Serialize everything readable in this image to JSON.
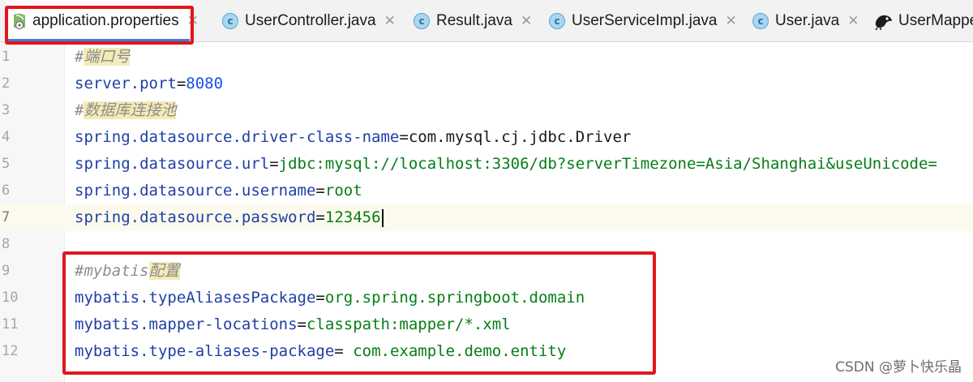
{
  "tabs": [
    {
      "label": "application.properties",
      "icon": "spring-properties-icon",
      "active": true
    },
    {
      "label": "UserController.java",
      "icon": "java-class-icon",
      "active": false
    },
    {
      "label": "Result.java",
      "icon": "java-class-icon",
      "active": false
    },
    {
      "label": "UserServiceImpl.java",
      "icon": "java-class-icon",
      "active": false
    },
    {
      "label": "User.java",
      "icon": "java-class-icon",
      "active": false
    },
    {
      "label": "UserMappe",
      "icon": "mybatis-bird-icon",
      "active": false
    }
  ],
  "tab_close_glyph": "✕",
  "class_icon_letter": "c",
  "lines": [
    {
      "num": "1",
      "comment_prefix": "#",
      "comment_text": "端口号"
    },
    {
      "num": "2",
      "key": "server.port",
      "eq": "=",
      "value": "8080"
    },
    {
      "num": "3",
      "comment_prefix": "#",
      "comment_text": "数据库连接池"
    },
    {
      "num": "4",
      "key": "spring.datasource.driver-class-name",
      "eq": "=",
      "value": "com.mysql.cj.jdbc.Driver"
    },
    {
      "num": "5",
      "key": "spring.datasource.url",
      "eq": "=",
      "value": "jdbc:mysql://localhost:3306/db?serverTimezone=Asia/Shanghai&useUnicode="
    },
    {
      "num": "6",
      "key": "spring.datasource.username",
      "eq": "=",
      "value": "root"
    },
    {
      "num": "7",
      "key": "spring.datasource.password",
      "eq": "=",
      "value": "123456"
    },
    {
      "num": "8"
    },
    {
      "num": "9",
      "comment_prefix": "#mybatis",
      "comment_text": "配置"
    },
    {
      "num": "10",
      "key": "mybatis.typeAliasesPackage",
      "eq": "=",
      "value": "org.spring.springboot.domain"
    },
    {
      "num": "11",
      "key": "mybatis.mapper-locations",
      "eq": "=",
      "value": "classpath:mapper/*.xml"
    },
    {
      "num": "12",
      "key": "mybatis.type-aliases-package",
      "eq": "=",
      "value": " com.example.demo.entity"
    }
  ],
  "watermark": "CSDN @萝卜快乐晶",
  "colors": {
    "highlight_box": "#e0171d",
    "key": "#1f3fa6",
    "value": "#067d17",
    "number": "#1750eb",
    "comment": "#8c8c8c",
    "current_line": "#fcfaed"
  }
}
